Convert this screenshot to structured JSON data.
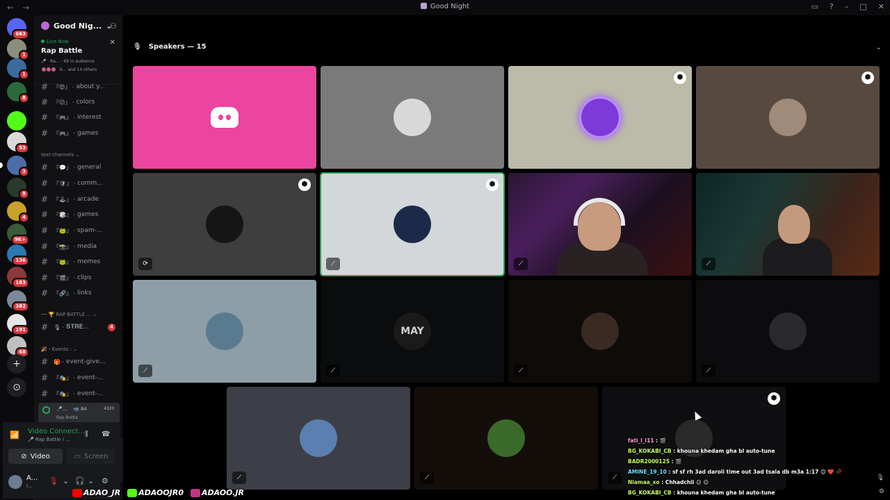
{
  "window": {
    "title": "Good Night",
    "back_icon": "←",
    "forward_icon": "→"
  },
  "servers": [
    {
      "badge": "663",
      "color": "#5865f2"
    },
    {
      "badge": "1",
      "color": "#8a8f7a"
    },
    {
      "badge": "1",
      "color": "#3d6a9e"
    },
    {
      "badge": "8",
      "color": "#2a6a3a"
    },
    {
      "badge": "",
      "color": "#53fc18"
    },
    {
      "badge": "53",
      "color": "#d8d8d8"
    },
    {
      "badge": "3",
      "color": "#4c6ea8"
    },
    {
      "badge": "9",
      "color": "#2a3a2a"
    },
    {
      "badge": "4",
      "color": "#c7a12a"
    },
    {
      "badge": "9K+",
      "color": "#3a5a3a"
    },
    {
      "badge": "136",
      "color": "#2a7ab0"
    },
    {
      "badge": "183",
      "color": "#8a3a3a"
    },
    {
      "badge": "382",
      "color": "#7a8a9a"
    },
    {
      "badge": "191",
      "color": "#e6e6e6"
    },
    {
      "badge": "68",
      "color": "#c0c0c0"
    }
  ],
  "server_header": {
    "name": "Good Nig...",
    "chevron": "⌄"
  },
  "live_now": {
    "label": "Live Now",
    "title": "Rap Battle",
    "meta": "🎤 · Ra... · 69 in audience",
    "attendees": "b... and 14 others"
  },
  "channels": [
    {
      "prefix": "『😍』",
      "name": "about y...",
      "type": "text"
    },
    {
      "prefix": "『😕』",
      "name": "colors",
      "type": "text"
    },
    {
      "prefix": "『🎮』",
      "name": "interest",
      "type": "text"
    },
    {
      "prefix": "『🎮』",
      "name": "games",
      "type": "text"
    },
    {
      "prefix": "『💬』",
      "name": "general",
      "type": "text"
    },
    {
      "prefix": "『🛡』",
      "name": "comm...",
      "type": "text"
    },
    {
      "prefix": "『🕹』",
      "name": "arcade",
      "type": "text"
    },
    {
      "prefix": "『🎲』",
      "name": "games",
      "type": "text"
    },
    {
      "prefix": "『🐸』",
      "name": "spam-...",
      "type": "text"
    },
    {
      "prefix": "『📸』",
      "name": "media",
      "type": "text"
    },
    {
      "prefix": "『🐸』",
      "name": "memes",
      "type": "text"
    },
    {
      "prefix": "『🎬』",
      "name": "clips",
      "type": "text"
    },
    {
      "prefix": "『🔗』",
      "name": "links",
      "type": "text"
    },
    {
      "prefix": "🎙",
      "name": "𝐒𝐓𝐑𝐄...",
      "type": "text",
      "badge": "4"
    },
    {
      "prefix": "🎁",
      "name": "event-give...",
      "type": "text"
    },
    {
      "prefix": "『🎭』",
      "name": "event-...",
      "type": "text"
    },
    {
      "prefix": "『🎭』",
      "name": "event-...",
      "type": "text"
    }
  ],
  "categories": {
    "text": "text channels",
    "rap": "── 🏆 RAP BATTLE ...",
    "events": "🎉・Events :"
  },
  "voice_channel": {
    "name": "🎤...",
    "streamers": "84",
    "count": "4320",
    "subtitle": "Rap Battle"
  },
  "connection": {
    "title": "Video Connect...",
    "subtitle": "🎤 Rap Battle / ...",
    "video_label": "Video",
    "screen_label": "Screen"
  },
  "user": {
    "name": "A...",
    "status": "I..."
  },
  "stage": {
    "speakers_label": "Speakers — 15"
  },
  "tiles": [
    {
      "name": "discord-default-tile",
      "bg": "#eb459f",
      "shield": false,
      "status": ""
    },
    {
      "name": "speaker-tile-2",
      "bg": "#7a7a7a",
      "avatar": "#d8d8d8",
      "shield": false,
      "status": ""
    },
    {
      "name": "speaker-tile-3",
      "bg": "#bcbaa8",
      "avatar": "#7c3ad8",
      "shield": true,
      "status": ""
    },
    {
      "name": "speaker-tile-4",
      "bg": "#58493f",
      "avatar": "#a08a7a",
      "shield": true,
      "status": ""
    },
    {
      "name": "speaker-tile-5",
      "bg": "#3e3e3e",
      "avatar": "#151515",
      "shield": true,
      "status": "⟳"
    },
    {
      "name": "speaker-tile-6",
      "bg": "#d3d7da",
      "avatar": "#1c2a4a",
      "shield": true,
      "status": "⟋"
    },
    {
      "name": "camera-tile-1",
      "bg": "cam1",
      "shield": false,
      "status": "⟋"
    },
    {
      "name": "camera-tile-2",
      "bg": "cam2",
      "shield": false,
      "status": "⟋"
    },
    {
      "name": "speaker-tile-9",
      "bg": "#8d9ea6",
      "avatar": "#5a7a90",
      "shield": false,
      "status": "⟋"
    },
    {
      "name": "speaker-tile-10",
      "bg": "#0a0c0e",
      "avatar": "#1a1a1a",
      "shield": false,
      "status": "⟋",
      "logo_text": "MAY"
    },
    {
      "name": "speaker-tile-11",
      "bg": "#0e0b09",
      "avatar": "#3a2a22",
      "shield": false,
      "status": "⟋"
    },
    {
      "name": "speaker-tile-12",
      "bg": "#0c0c0e",
      "avatar": "#2a2a2e",
      "shield": false,
      "status": "⟋"
    },
    {
      "name": "speaker-tile-13",
      "bg": "#3c3f47",
      "avatar": "#5a7fb0",
      "shield": false,
      "status": "⟋"
    },
    {
      "name": "speaker-tile-14",
      "bg": "#140e0b",
      "avatar": "#3a6a2a",
      "shield": false,
      "status": "⟋"
    },
    {
      "name": "speaker-tile-15",
      "bg": "#0f0f11",
      "avatar": "#2a2a2a",
      "shield": true,
      "status": "⟋"
    }
  ],
  "chat_overlay": [
    {
      "user": "fati_l_l11",
      "sep": " : ",
      "msg": "🎬",
      "color": "#ff9de0"
    },
    {
      "user": "BG_KOKABI_CB",
      "sep": " : ",
      "msg": "khouna khedam gha bl auto-tune",
      "color": "#c8ff5a"
    },
    {
      "user": "BADR2000125",
      "sep": " : ",
      "msg": "🎬",
      "color": "#c8ff5a"
    },
    {
      "user": "AMINE_19_10",
      "sep": " : ",
      "msg": "sf sf rh 3ad daroli time out 3ad tsala db m3a 1:17 😊 ❤️ 🥀",
      "color": "#6ae0ff"
    },
    {
      "user": "Niamaa_xo",
      "sep": " : ",
      "msg": "Chhadchii 😐 😐",
      "color": "#c8ff5a"
    },
    {
      "user": "BG_KOKABI_CB",
      "sep": " : ",
      "msg": "khouna khedam gha bl auto-tune",
      "color": "#c8ff5a"
    }
  ],
  "watermark": [
    {
      "label": "ADAO_JR",
      "color": "#ff0000"
    },
    {
      "label": "ADAOOJR0",
      "color": "#53fc18"
    },
    {
      "label": "ADAOO.JR",
      "color": "#c13584"
    }
  ]
}
